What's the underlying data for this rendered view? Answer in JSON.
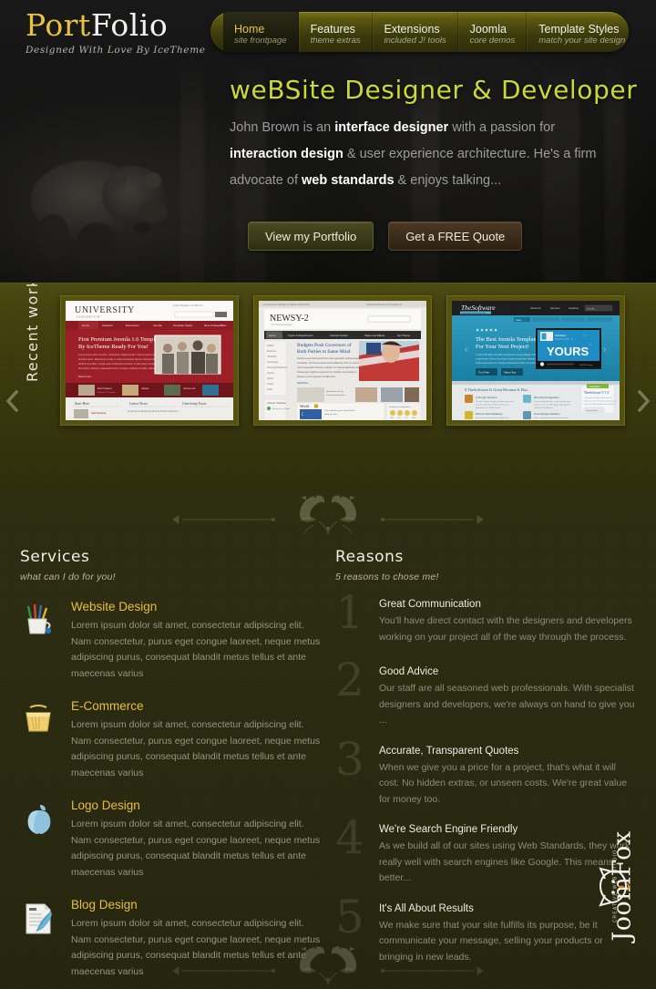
{
  "logo": {
    "part1": "Port",
    "part2": "Folio",
    "tagline": "Designed With Love By IceTheme"
  },
  "nav": {
    "items": [
      {
        "title": "Home",
        "sub": "site frontpage",
        "active": true
      },
      {
        "title": "Features",
        "sub": "theme extras",
        "active": false
      },
      {
        "title": "Extensions",
        "sub": "included J! tools",
        "active": false
      },
      {
        "title": "Joomla",
        "sub": "core demos",
        "active": false
      },
      {
        "title": "Template Styles",
        "sub": "match your site design",
        "active": false
      }
    ]
  },
  "hero": {
    "title": "weBSite Designer & Developer",
    "desc_parts": [
      {
        "text": "John Brown is an ",
        "bold": false
      },
      {
        "text": "interface designer",
        "bold": true
      },
      {
        "text": " with a passion for ",
        "bold": false
      },
      {
        "text": "interaction design",
        "bold": true
      },
      {
        "text": " & user experience architecture. He's a firm advocate of ",
        "bold": false
      },
      {
        "text": "web standards",
        "bold": true
      },
      {
        "text": " & enjoys talking...",
        "bold": false
      }
    ],
    "buttons": {
      "primary": "View my Portfolio",
      "secondary": "Get a FREE Quote"
    },
    "background_image": "bear-in-forest-photo"
  },
  "portfolio": {
    "label": "Recent work",
    "prev_arrow": "chevron-left-icon",
    "next_arrow": "chevron-right-icon",
    "items": [
      {
        "site_name": "UNIVERSITY",
        "site_sub": "Established in 1897",
        "headline": "First Premium Joomla 1.6 Template By IceTheme Ready For You!",
        "accent": "#9c1f28",
        "nav": [
          "Home",
          "Features",
          "Extensions",
          "Joomla",
          "Template Styles",
          "New IceRegalBlos"
        ],
        "footer_cols": [
          "Start Here",
          "Latest News",
          "University Facts"
        ]
      },
      {
        "site_name": "NEWSY-2",
        "site_sub": "Your Daily Newspaper",
        "headline": "Budgets Push Governors of Both Parties to Same Mind",
        "accent": "#2b2b2b",
        "nav": [
          "Home",
          "Topics & Departments",
          "Joomla Content",
          "Styles and Effects",
          "Get Theme"
        ],
        "section_label": "World"
      },
      {
        "site_name": "TheSoftware",
        "site_sub": "Responsive Joomla Template",
        "headline": "The Best Joomla Template For Your Next Project!",
        "accent": "#1a9bc4",
        "banner_word": "YOURS",
        "buttons": [
          "Try It Free",
          "Take a Tour"
        ],
        "features_title": "8 TheSoftware Is Great Because It Has...",
        "features": [
          "A Simple Solution",
          "Extended Integration",
          "Pixel to Size Relativity",
          "Core Design Patterns"
        ],
        "side_box_title": "TheSoftware V 1.0"
      }
    ]
  },
  "services": {
    "title": "Services",
    "subtitle": "what can I do for you!",
    "body_text": "Lorem ipsum dolor sit amet, consectetur adipiscing elit. Nam consectetur, purus eget congue laoreet, neque metus adipiscing purus, consequat blandit metus tellus et ante maecenas varius",
    "items": [
      {
        "title": "Website Design",
        "icon": "pencil-cup-icon"
      },
      {
        "title": "E-Commerce",
        "icon": "shopping-basket-icon"
      },
      {
        "title": "Logo Design",
        "icon": "apple-logo-icon"
      },
      {
        "title": "Blog Design",
        "icon": "document-quill-icon"
      }
    ]
  },
  "reasons": {
    "title": "Reasons",
    "subtitle": "5 reasons to chose me!",
    "items": [
      {
        "number": "1",
        "title": "Great Communication",
        "text": "You'll have direct contact with the designers and developers working on your project all of the way through the process."
      },
      {
        "number": "2",
        "title": "Good Advice",
        "text": "Our staff are all seasoned web professionals. With specialist designers and developers, we're always on hand to give you ..."
      },
      {
        "number": "3",
        "title": "Accurate, Transparent Quotes",
        "text": "When we give you a price for a project, that's what it will cost. No hidden extras, or unseen costs. We're great value for money too."
      },
      {
        "number": "4",
        "title": "We're Search Engine Friendly",
        "text": "As we build all of our sites using Web Standards, they work really well with search engines like Google. This means better..."
      },
      {
        "number": "5",
        "title": "It's All About Results",
        "text": "We make sure that your site fulfills its purpose, be it communicate your message, selling your products or bringing in new leads."
      }
    ]
  },
  "watermark": {
    "text": "JoomFox",
    "subtitle": "CREATIVE WEB STUDIO",
    "icon": "fox-head-icon"
  },
  "ornaments": {
    "top": "two-birds-divider",
    "bottom": "two-birds-divider"
  },
  "colors": {
    "accent_yellow": "#e8c240",
    "hero_title_green": "#cbd83a",
    "olive_band": "#3c3a0d",
    "page_dark_olive": "#2a2a11",
    "header_black": "#121212"
  }
}
